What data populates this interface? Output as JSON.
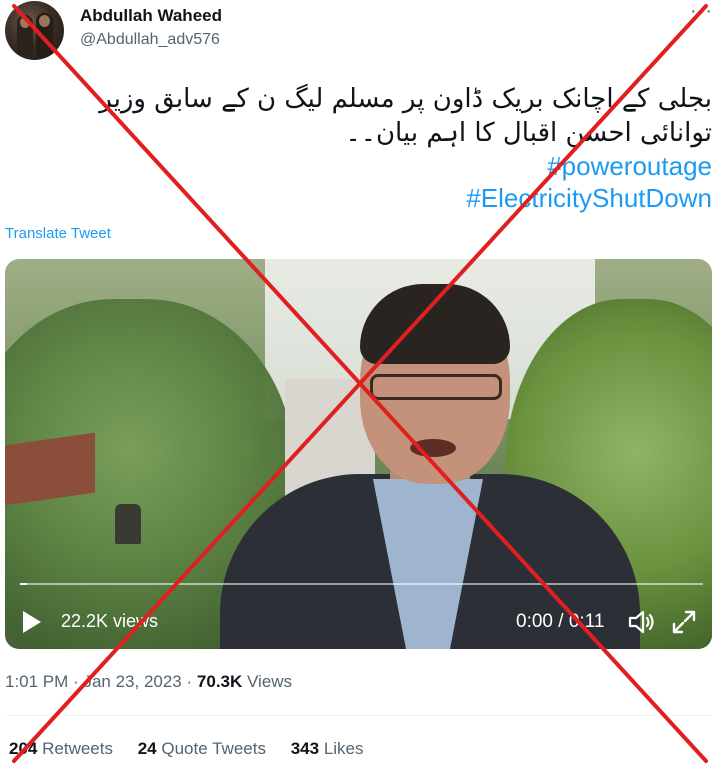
{
  "author": {
    "name": "Abdullah Waheed",
    "handle": "@Abdullah_adv576"
  },
  "more_label": "···",
  "tweet": {
    "urdu_line1": "بجلی کے اچانک بریک ڈاون پر مسلم لیگ ن کے سابق وزیر",
    "urdu_line2": "توانائی احسن اقبال کا اہم بیان۔۔",
    "hashtag1": "#poweroutage",
    "hashtag2": "#ElectricityShutDown"
  },
  "translate_label": "Translate Tweet",
  "video": {
    "views": "22.2K views",
    "time": "0:00 / 0:11",
    "progress": 0.01
  },
  "meta": {
    "time": "1:01 PM",
    "sep1": "·",
    "date": "Jan 23, 2023",
    "sep2": "·",
    "views_count": "70.3K",
    "views_label": "Views"
  },
  "stats": {
    "retweets_count": "204",
    "retweets_label": "Retweets",
    "quotes_count": "24",
    "quotes_label": "Quote Tweets",
    "likes_count": "343",
    "likes_label": "Likes"
  },
  "colors": {
    "accent": "#1d9bf0",
    "overlay_x": "#e02020"
  }
}
